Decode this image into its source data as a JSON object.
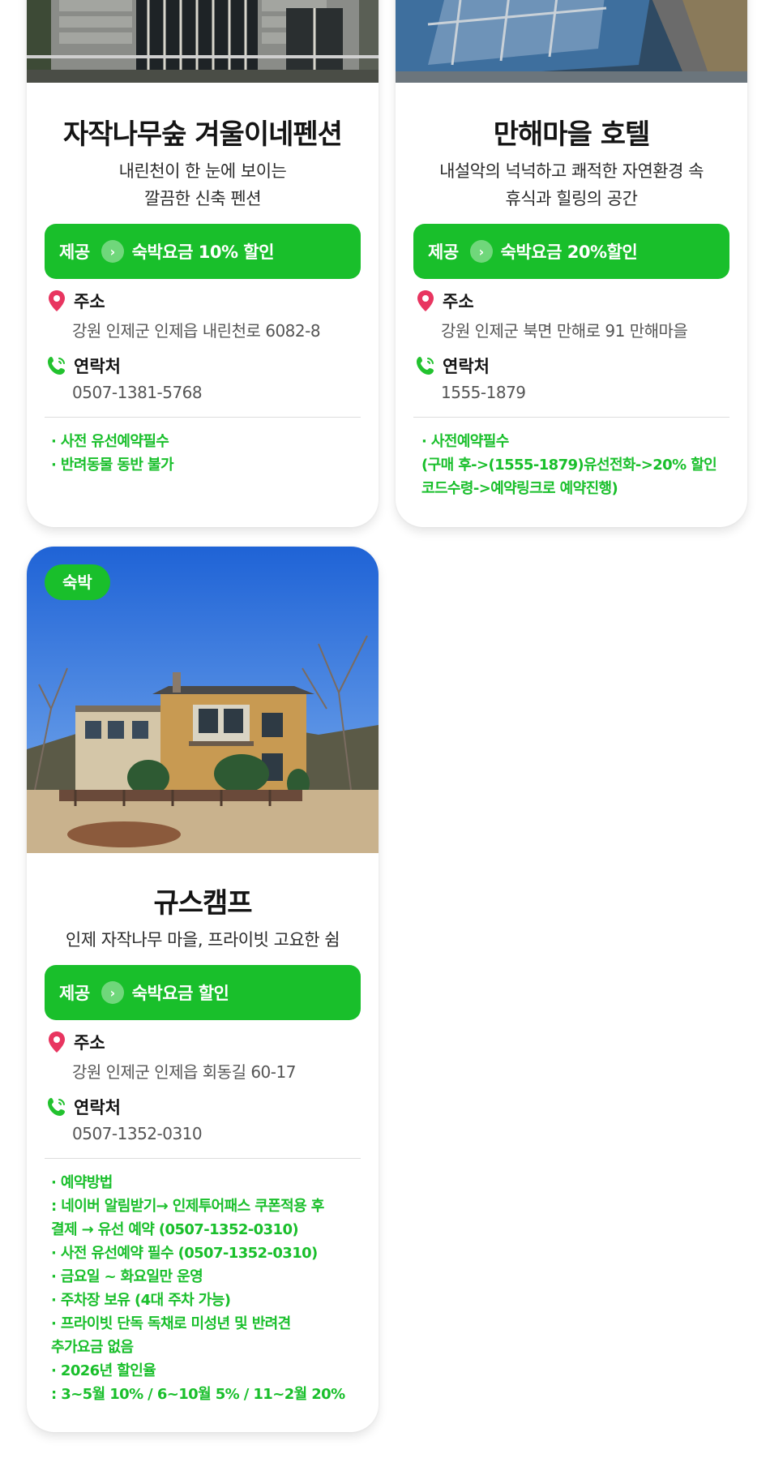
{
  "colors": {
    "accent": "#19bf2b",
    "pin": "#e83560",
    "phone": "#22c22e"
  },
  "labels": {
    "address": "주소",
    "contact": "연락처",
    "provide": "제공"
  },
  "cards": [
    {
      "title": "자작나무숲 겨울이네펜션",
      "subtitle": [
        "내린천이 한 눈에 보이는",
        "깔끔한 신축 펜션"
      ],
      "benefit": "숙박요금 10% 할인",
      "address": "강원 인제군 인제읍 내린천로 6082-8",
      "phone": "0507-1381-5768",
      "notes": [
        "· 사전 유선예약필수",
        "· 반려동물 동반 불가"
      ]
    },
    {
      "title": "만해마을 호텔",
      "subtitle": [
        "내설악의 넉넉하고 쾌적한 자연환경 속",
        "휴식과 힐링의 공간"
      ],
      "benefit": "숙박요금 20%할인",
      "address": "강원 인제군 북면 만해로 91 만해마을",
      "phone": "1555-1879",
      "notes": [
        "· 사전예약필수",
        "(구매 후->(1555-1879)유선전화->20% 할인",
        " 코드수령->예약링크로 예약진행)"
      ]
    },
    {
      "tag": "숙박",
      "title": "규스캠프",
      "subtitle": [
        "인제 자작나무 마을, 프라이빗 고요한 쉼"
      ],
      "benefit": "숙박요금 할인",
      "address": "강원 인제군 인제읍 회동길 60-17",
      "phone": "0507-1352-0310",
      "notes": [
        "· 예약방법",
        ": 네이버 알림받기→ 인제투어패스 쿠폰적용 후",
        "  결제 → 유선 예약 (0507-1352-0310)",
        "· 사전 유선예약 필수 (0507-1352-0310)",
        "· 금요일 ~ 화요일만 운영",
        "· 주차장 보유 (4대 주차 가능)",
        "· 프라이빗 단독 독채로 미성년 및 반려견",
        "  추가요금 없음",
        "· 2026년 할인율",
        ": 3~5월 10% / 6~10월 5% / 11~2월 20%"
      ]
    }
  ]
}
